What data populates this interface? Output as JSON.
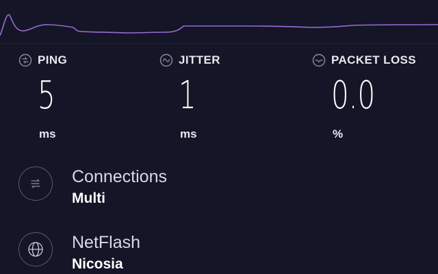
{
  "graph": {
    "line_color": "#9b6bd6",
    "icon": "latency-graph"
  },
  "metrics": {
    "ping": {
      "label": "PING",
      "value": "5",
      "unit": "ms",
      "icon": "ping-icon"
    },
    "jitter": {
      "label": "JITTER",
      "value": "1",
      "unit": "ms",
      "icon": "jitter-icon"
    },
    "packet_loss": {
      "label": "PACKET LOSS",
      "value": "0.0",
      "unit": "%",
      "icon": "packet-loss-icon"
    }
  },
  "connections": {
    "title": "Connections",
    "value": "Multi",
    "icon": "connections-icon"
  },
  "server": {
    "title": "NetFlash",
    "value": "Nicosia",
    "icon": "globe-icon"
  },
  "colors": {
    "background": "#141526",
    "accent": "#9b6bd6",
    "icon_stroke": "#8a8ca0"
  }
}
